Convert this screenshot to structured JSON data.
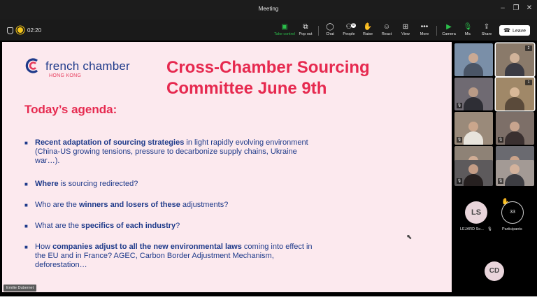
{
  "window": {
    "title": "Meeting",
    "controls": {
      "minimize": "–",
      "maximize": "❐",
      "close": "✕"
    }
  },
  "toolbar": {
    "timer": "02:20",
    "buttons": [
      {
        "label": "Take control",
        "icon": "take-control-icon",
        "glyph": "▣"
      },
      {
        "label": "Pop out",
        "icon": "pop-out-icon",
        "glyph": "⧉"
      },
      {
        "label": "Chat",
        "icon": "chat-icon",
        "glyph": "◯"
      },
      {
        "label": "People",
        "icon": "people-icon",
        "glyph": "⚇"
      },
      {
        "label": "Raise",
        "icon": "raise-hand-icon",
        "glyph": "✋"
      },
      {
        "label": "React",
        "icon": "react-icon",
        "glyph": "☺"
      },
      {
        "label": "View",
        "icon": "view-icon",
        "glyph": "⊞"
      },
      {
        "label": "More",
        "icon": "more-icon",
        "glyph": "•••"
      },
      {
        "label": "Camera",
        "icon": "camera-icon",
        "glyph": "▶"
      },
      {
        "label": "Mic",
        "icon": "mic-icon",
        "glyph": "🎙"
      },
      {
        "label": "Share",
        "icon": "share-icon",
        "glyph": "⇪"
      }
    ],
    "people_badge": "8",
    "leave_label": "Leave",
    "accent_green": "#2bbf4b"
  },
  "slide": {
    "logo_name": "french chamber",
    "logo_sub": "HONG KONG",
    "title": "Cross-Chamber Sourcing Committee June 9th",
    "agenda_heading": "Today’s agenda:",
    "items": [
      {
        "pre": "",
        "bold": "Recent adaptation of sourcing strategies",
        "post": " in light rapidly evolving environment (China-US growing tensions, pressure to decarbonize supply chains, Ukraine war…)."
      },
      {
        "pre": "",
        "bold": "Where",
        "post": " is sourcing redirected?"
      },
      {
        "pre": "Who are the ",
        "bold": "winners and losers of these",
        "post": " adjustments?"
      },
      {
        "pre": "What are the ",
        "bold": "specifics of each industry",
        "post": "?"
      },
      {
        "pre": "How ",
        "bold": "companies adjust to all the new environmental laws",
        "post": " coming into effect in the EU and in France? AGEC, Carbon Border Adjustment Mechanism, deforestation…"
      }
    ],
    "colors": {
      "title": "#e6294f",
      "body": "#1e3a8a",
      "background": "#fce9ee"
    },
    "presenter_name": "Emilie Dubernet"
  },
  "participants": {
    "tiles": [
      {
        "tag": "",
        "bg": "#7a8fa8"
      },
      {
        "tag": "2",
        "bg": "#8a7a6a"
      },
      {
        "tag": "",
        "bg": "#6f6a72"
      },
      {
        "tag": "1",
        "bg": "#a08868"
      },
      {
        "tag": "",
        "bg": "#9a8a7a"
      },
      {
        "tag": "",
        "bg": "#7d6f68"
      },
      {
        "tag": "",
        "bg": "#8e8276"
      },
      {
        "tag": "",
        "bg": "#6a6a70"
      },
      {
        "tag": "",
        "bg": "#5d5a5c"
      },
      {
        "tag": "",
        "bg": "#a39a95"
      }
    ],
    "ls_initials": "LS",
    "ls_name": "LEJARD So...",
    "count": "33",
    "count_label": "Participants",
    "cd_initials": "CD"
  }
}
